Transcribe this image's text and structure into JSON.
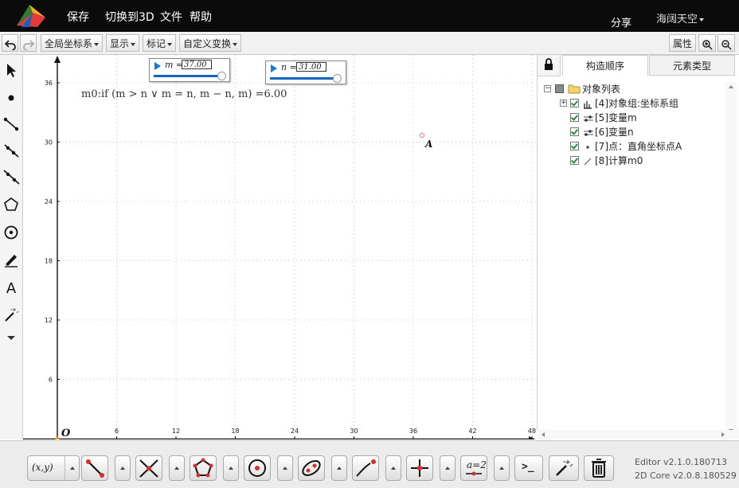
{
  "topbar": {
    "menu": [
      "保存",
      "切换到3D",
      "文件",
      "帮助"
    ],
    "share": "分享",
    "user": "海阔天空"
  },
  "toolbar": {
    "coord": "全局坐标系",
    "display": "显示",
    "mark": "标记",
    "custom_transform": "自定义变换",
    "properties": "属性"
  },
  "sliders": [
    {
      "name": "m",
      "value": "37.00",
      "fraction": 0.97
    },
    {
      "name": "n",
      "value": "31.00",
      "fraction": 0.95
    }
  ],
  "formula": {
    "text": "m0:if (m > n ∨ m = n, m − n, m) =6.00"
  },
  "graph": {
    "x_ticks": [
      "6",
      "12",
      "18",
      "24",
      "30",
      "36",
      "42",
      "48"
    ],
    "y_ticks": [
      "36",
      "30",
      "24",
      "18",
      "12",
      "6"
    ],
    "origin_label": "O",
    "point_label": "A"
  },
  "panel": {
    "tabs": [
      "构造顺序",
      "元素类型"
    ],
    "root": "对象列表",
    "items": [
      {
        "label": "[4]对象组:坐标系组",
        "icon": "bar-chart-icon",
        "expandable": true
      },
      {
        "label": "[5]变量m",
        "icon": "slider-icon"
      },
      {
        "label": "[6]变量n",
        "icon": "slider-icon"
      },
      {
        "label": "[7]点：直角坐标点A",
        "icon": "point-icon"
      },
      {
        "label": "[8]计算m0",
        "icon": "calc-icon"
      }
    ]
  },
  "bottom": {
    "coord_label": "(x,y)",
    "measure_label": "a=2",
    "cmd_label": ">_"
  },
  "version": {
    "editor": "Editor v2.1.0.180713",
    "core": "2D Core v2.0.8.180529"
  },
  "colors": {
    "accent": "#1565c0",
    "tool_red": "#d32f2f",
    "topbar": "#0b0b0b"
  }
}
